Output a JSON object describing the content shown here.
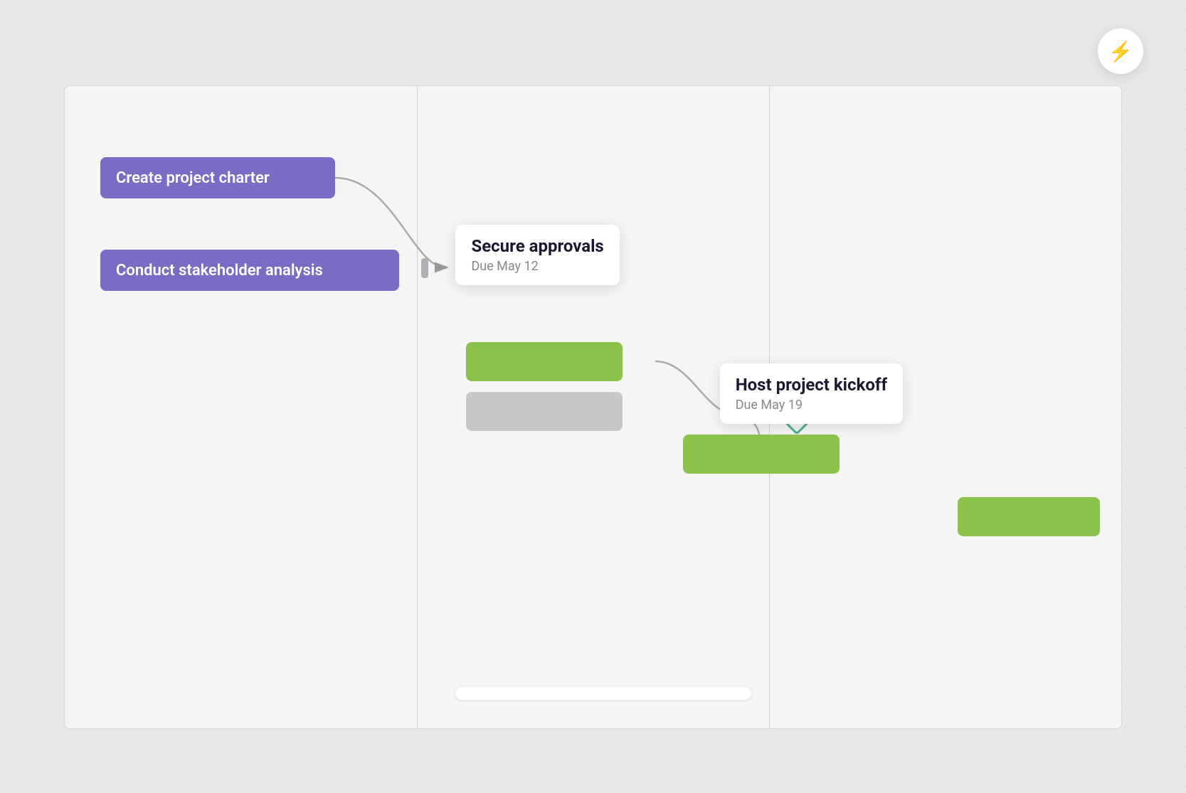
{
  "lightning_button": {
    "icon": "⚡",
    "label": "lightning-action"
  },
  "tasks": {
    "create_charter": {
      "label": "Create project charter"
    },
    "conduct_stakeholder": {
      "label": "Conduct stakeholder analysis"
    }
  },
  "tooltips": {
    "secure_approvals": {
      "title": "Secure approvals",
      "due": "Due May 12"
    },
    "host_kickoff": {
      "title": "Host project kickoff",
      "due": "Due May 19"
    }
  },
  "colors": {
    "purple": "#7c6bc4",
    "green": "#8bc34a",
    "gray": "#c8c8ca",
    "milestone_border": "#4cba8a",
    "background": "#e8e8ea",
    "card_bg": "#ffffff",
    "lightning_color": "#f5a623"
  }
}
